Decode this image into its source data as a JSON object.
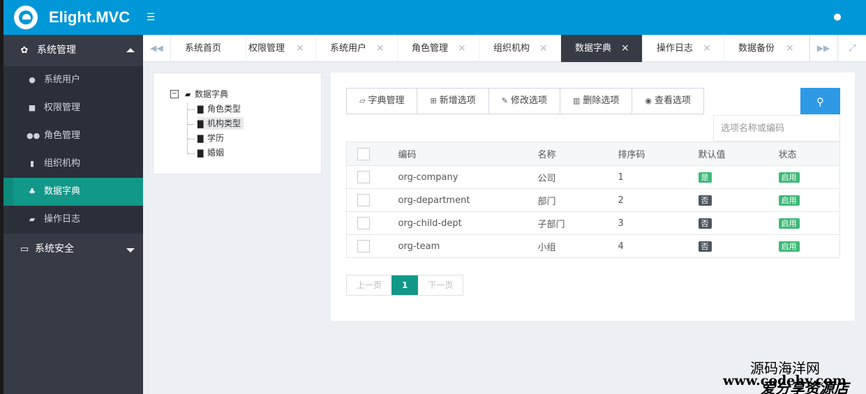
{
  "header": {
    "brand": "Elight.MVC",
    "menu_toggle_icon": "list-icon",
    "user_icon": "user-icon",
    "color": "#0097d8"
  },
  "sidebar": {
    "groups": [
      {
        "label": "系统管理",
        "icon": "cogs-icon",
        "expanded": true,
        "items": [
          {
            "label": "系统用户",
            "icon": "user-circle-icon"
          },
          {
            "label": "权限管理",
            "icon": "briefcase-icon"
          },
          {
            "label": "角色管理",
            "icon": "users-icon"
          },
          {
            "label": "组织机构",
            "icon": "building-icon"
          },
          {
            "label": "数据字典",
            "icon": "sitemap-icon",
            "active": true
          },
          {
            "label": "操作日志",
            "icon": "folder-open-icon"
          }
        ]
      },
      {
        "label": "系统安全",
        "icon": "desktop-icon",
        "expanded": false
      }
    ]
  },
  "tabs": [
    {
      "label": "系统首页",
      "closable": false
    },
    {
      "label": "权限管理",
      "closable": true
    },
    {
      "label": "系统用户",
      "closable": true
    },
    {
      "label": "角色管理",
      "closable": true
    },
    {
      "label": "组织机构",
      "closable": true
    },
    {
      "label": "数据字典",
      "closable": true,
      "active": true
    },
    {
      "label": "操作日志",
      "closable": true
    },
    {
      "label": "数据备份",
      "closable": true
    }
  ],
  "tree": {
    "root": "数据字典",
    "toggle": "−",
    "children": [
      "角色类型",
      "机构类型",
      "学历",
      "婚姻"
    ],
    "selected": "机构类型"
  },
  "toolbar": {
    "buttons": [
      {
        "label": "字典管理",
        "icon": "folder-open-icon"
      },
      {
        "label": "新增选项",
        "icon": "plus-square-icon"
      },
      {
        "label": "修改选项",
        "icon": "edit-icon"
      },
      {
        "label": "删除选项",
        "icon": "trash-icon"
      },
      {
        "label": "查看选项",
        "icon": "eye-icon"
      }
    ],
    "search_placeholder": "选项名称或编码",
    "search_icon": "search-icon"
  },
  "table": {
    "columns": [
      "编码",
      "名称",
      "排序码",
      "默认值",
      "状态"
    ],
    "rows": [
      {
        "code": "org-company",
        "name": "公司",
        "sort": "1",
        "default": "是",
        "status": "启用"
      },
      {
        "code": "org-department",
        "name": "部门",
        "sort": "2",
        "default": "否",
        "status": "启用"
      },
      {
        "code": "org-child-dept",
        "name": "子部门",
        "sort": "3",
        "default": "否",
        "status": "启用"
      },
      {
        "code": "org-team",
        "name": "小组",
        "sort": "4",
        "default": "否",
        "status": "启用"
      }
    ]
  },
  "pager": {
    "prev": "上一页",
    "current": "1",
    "next": "下一页"
  },
  "watermark": {
    "line1": "源码海洋网",
    "line2": "www.codehy.com",
    "line3": "爱分享资源店"
  },
  "colors": {
    "header": "#0097d8",
    "sidebar": "#363b45",
    "active": "#129889",
    "badge_green": "#3eb977",
    "badge_dark": "#4d5661",
    "search": "#2e9ae6"
  }
}
